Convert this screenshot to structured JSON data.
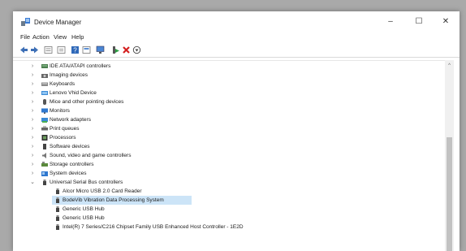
{
  "window": {
    "title": "Device Manager",
    "controls": {
      "minimize": "–",
      "maximize": "☐",
      "close": "✕"
    }
  },
  "menu": [
    "File",
    "Action",
    "View",
    "Help"
  ],
  "toolbar": [
    {
      "icon": "back-arrow-icon"
    },
    {
      "icon": "forward-arrow-icon"
    },
    {
      "icon": "properties-icon"
    },
    {
      "icon": "list-view-icon"
    },
    {
      "icon": "help-icon"
    },
    {
      "icon": "update-driver-icon"
    },
    {
      "icon": "monitor-scan-icon"
    },
    {
      "icon": "enable-device-icon"
    },
    {
      "icon": "uninstall-x-icon",
      "color": "#d42020"
    },
    {
      "icon": "download-driver-icon"
    }
  ],
  "tree": [
    {
      "label": "IDE ATA/ATAPI controllers",
      "icon": "ide-controller-icon",
      "expand": "›",
      "level": 0
    },
    {
      "label": "Imaging devices",
      "icon": "camera-icon",
      "expand": "›",
      "level": 0
    },
    {
      "label": "Keyboards",
      "icon": "keyboard-icon",
      "expand": "›",
      "level": 0
    },
    {
      "label": "Lenovo Vhid Device",
      "icon": "hid-device-icon",
      "expand": "›",
      "level": 0
    },
    {
      "label": "Mice and other pointing devices",
      "icon": "mouse-icon",
      "expand": "›",
      "level": 0
    },
    {
      "label": "Monitors",
      "icon": "monitor-icon",
      "expand": "›",
      "level": 0
    },
    {
      "label": "Network adapters",
      "icon": "network-adapter-icon",
      "expand": "›",
      "level": 0
    },
    {
      "label": "Print queues",
      "icon": "printer-icon",
      "expand": "›",
      "level": 0
    },
    {
      "label": "Processors",
      "icon": "processor-icon",
      "expand": "›",
      "level": 0
    },
    {
      "label": "Software devices",
      "icon": "software-device-icon",
      "expand": "›",
      "level": 0
    },
    {
      "label": "Sound, video and game controllers",
      "icon": "speaker-icon",
      "expand": "›",
      "level": 0
    },
    {
      "label": "Storage controllers",
      "icon": "storage-controller-icon",
      "expand": "›",
      "level": 0
    },
    {
      "label": "System devices",
      "icon": "system-folder-icon",
      "expand": "›",
      "level": 0
    },
    {
      "label": "Universal Serial Bus controllers",
      "icon": "usb-icon",
      "expand": "⌄",
      "level": 0
    },
    {
      "label": "Alcor Micro USB 2.0 Card Reader",
      "icon": "usb-icon",
      "expand": "",
      "level": 1
    },
    {
      "label": "BodeVib Vibration Data Processing System",
      "icon": "usb-icon",
      "expand": "",
      "level": 1,
      "selected": true
    },
    {
      "label": "Generic USB Hub",
      "icon": "usb-icon",
      "expand": "",
      "level": 1
    },
    {
      "label": "Generic USB Hub",
      "icon": "usb-icon",
      "expand": "",
      "level": 1
    },
    {
      "label": "Intel(R) 7 Series/C216 Chipset Family USB Enhanced Host Controller - 1E2D",
      "icon": "usb-icon",
      "expand": "",
      "level": 1
    }
  ],
  "scrollbar": {
    "up": "^"
  },
  "colors": {
    "selection": "#cce4f7",
    "accent": "#1f6fc5"
  }
}
